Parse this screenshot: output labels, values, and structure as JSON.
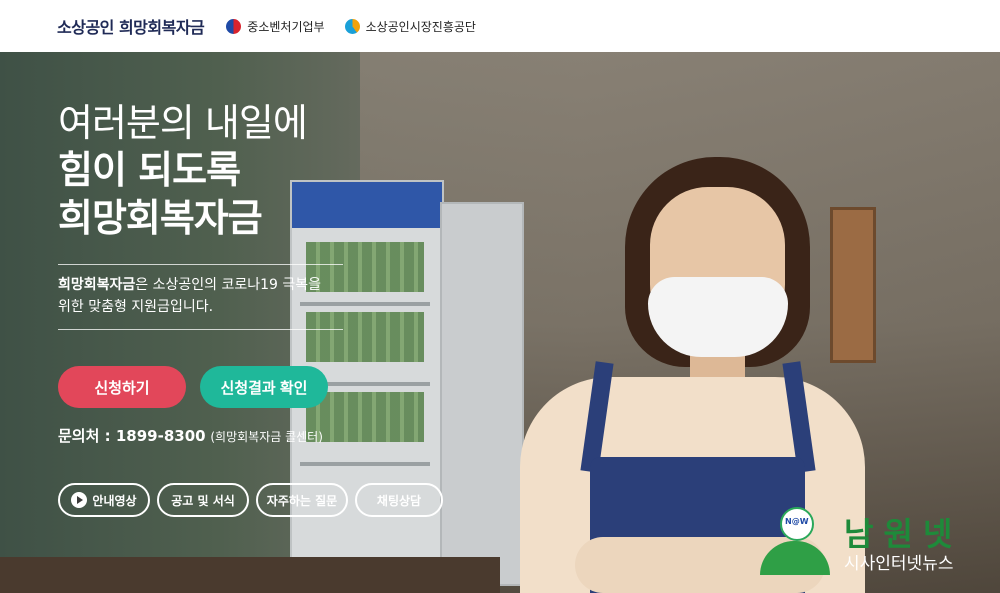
{
  "header": {
    "brand": "소상공인 희망회복자금",
    "ministry_1": "중소벤처기업부",
    "ministry_2": "소상공인시장진흥공단"
  },
  "hero": {
    "headline_line1": "여러분의 내일에",
    "headline_line2": "힘이 되도록",
    "headline_line3": "희망회복자금",
    "desc_strong": "희망회복자금",
    "desc_rest": "은 소상공인의 코로나19 극복을",
    "desc_line2": "위한 맞춤형 지원금입니다.",
    "apply_button": "신청하기",
    "result_button": "신청결과 확인",
    "contact_label": "문의처 : 1899-8300",
    "contact_sub": "(희망회복자금 콜센터)",
    "pills": {
      "video": "안내영상",
      "notice": "공고 및 서식",
      "faq": "자주하는 질문",
      "chat": "채팅상담"
    }
  },
  "watermark": {
    "name": "남원넷",
    "sub": "시사인터넷뉴스",
    "badge": "N@W"
  },
  "colors": {
    "apply": "#e2475a",
    "result": "#1fb89a",
    "brand": "#1f2a56"
  }
}
